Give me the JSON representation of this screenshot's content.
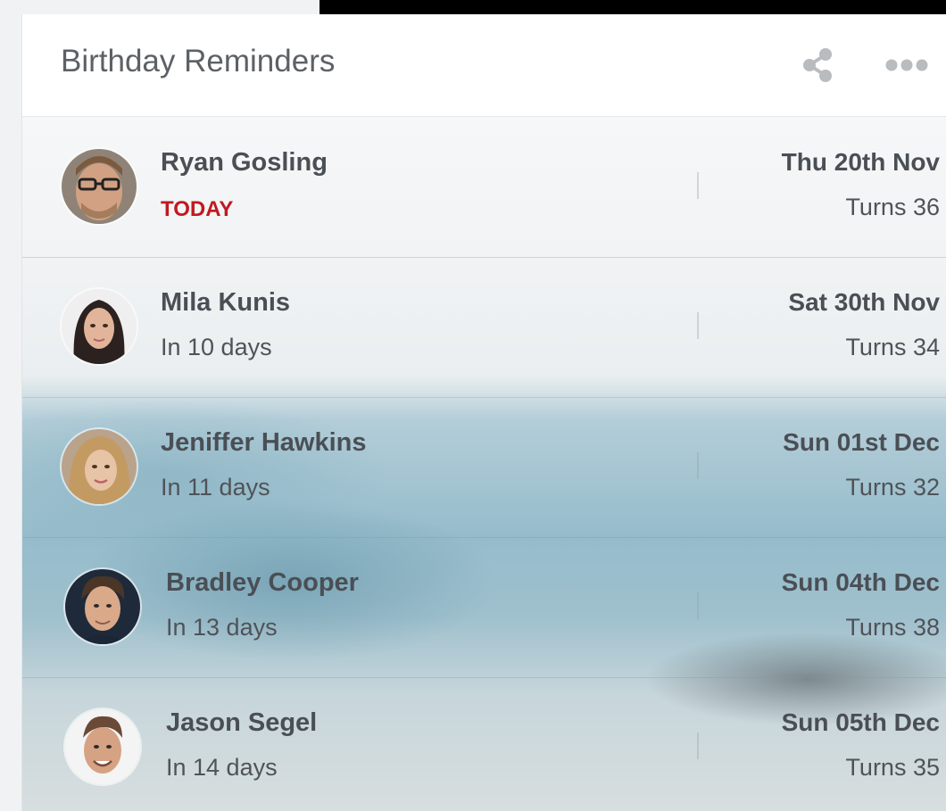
{
  "widget": {
    "title": "Birthday Reminders"
  },
  "icons": {
    "share": "share-icon",
    "more": "more-horizontal-icon"
  },
  "colors": {
    "today": "#c0191f",
    "text": "#4a4f55",
    "title": "#5d6166"
  },
  "reminders": [
    {
      "name": "Ryan Gosling",
      "status": "TODAY",
      "date": "Thu 20th Nov",
      "turns": "Turns 36"
    },
    {
      "name": "Mila Kunis",
      "status": "In 10 days",
      "date": "Sat 30th Nov",
      "turns": "Turns 34"
    },
    {
      "name": "Jeniffer Hawkins",
      "status": "In 11 days",
      "date": "Sun 01st Dec",
      "turns": "Turns 32"
    },
    {
      "name": "Bradley Cooper",
      "status": "In 13 days",
      "date": "Sun 04th Dec",
      "turns": "Turns 38"
    },
    {
      "name": "Jason Segel",
      "status": "In 14 days",
      "date": "Sun 05th Dec",
      "turns": "Turns 35"
    }
  ]
}
